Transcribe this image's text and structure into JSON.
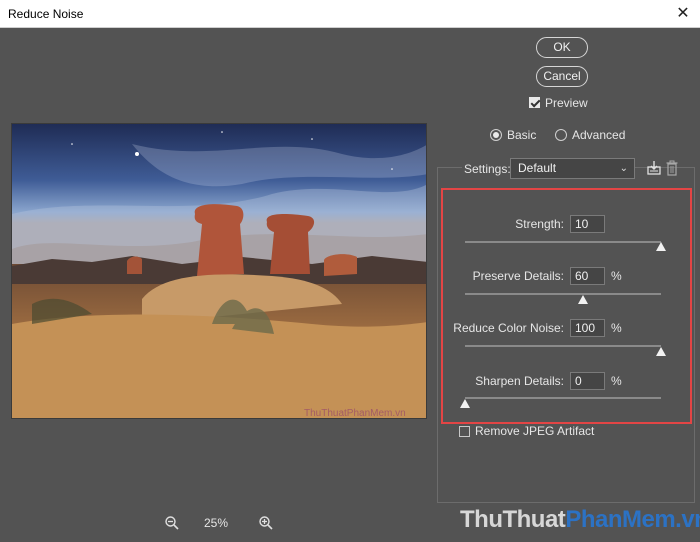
{
  "window": {
    "title": "Reduce Noise",
    "close_glyph": "✕"
  },
  "buttons": {
    "ok": "OK",
    "cancel": "Cancel"
  },
  "preview_toggle": {
    "label": "Preview",
    "checked": true
  },
  "mode": {
    "basic": "Basic",
    "advanced": "Advanced",
    "selected": "basic"
  },
  "settings": {
    "label": "Settings:",
    "value": "Default"
  },
  "sliders": [
    {
      "label": "Strength:",
      "value": "10",
      "unit": "",
      "fraction": 1.0
    },
    {
      "label": "Preserve Details:",
      "value": "60",
      "unit": "%",
      "fraction": 0.6
    },
    {
      "label": "Reduce Color Noise:",
      "value": "100",
      "unit": "%",
      "fraction": 1.0
    },
    {
      "label": "Sharpen Details:",
      "value": "0",
      "unit": "%",
      "fraction": 0.0
    }
  ],
  "jpeg_artifact": {
    "label": "Remove JPEG Artifact",
    "checked": false
  },
  "zoom": {
    "level": "25%"
  },
  "preview_watermark": "ThuThuatPhanMem.vn",
  "watermark": {
    "part1": "ThuThuat",
    "part2": "PhanMem.vn"
  },
  "colors": {
    "dialog_bg": "#535353",
    "highlight": "#e34545",
    "watermark_blue": "#2c72c4"
  }
}
